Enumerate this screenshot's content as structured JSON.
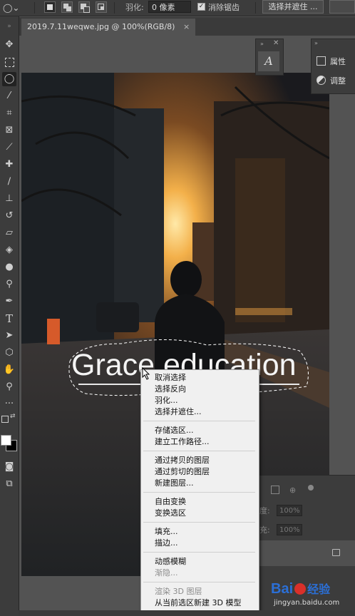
{
  "options_bar": {
    "feather_label": "羽化:",
    "feather_value": "0 像素",
    "antialias_label": "消除锯齿",
    "antialias_checked": true,
    "select_mask_label": "选择并遮住 ..."
  },
  "document": {
    "tab_title": "2019.7.11weqwe.jpg @ 100%(RGB/8)",
    "close_glyph": "×",
    "canvas_text": "Grace education"
  },
  "right_panels": {
    "items": [
      {
        "label": "属性",
        "icon": "properties-icon"
      },
      {
        "label": "调整",
        "icon": "adjustments-icon"
      }
    ],
    "character_glyph": "A"
  },
  "layers_panel": {
    "opacity_label": "度:",
    "opacity_value": "100%",
    "fill_label": "充:",
    "fill_value": "100%"
  },
  "context_menu": {
    "groups": [
      [
        "取消选择",
        "选择反向",
        "羽化...",
        "选择并遮住..."
      ],
      [
        "存储选区...",
        "建立工作路径..."
      ],
      [
        "通过拷贝的图层",
        "通过剪切的图层",
        "新建图层..."
      ],
      [
        "自由变换",
        "变换选区"
      ],
      [
        "填充...",
        "描边..."
      ],
      [
        "动感模糊",
        "渐隐..."
      ],
      [
        "渲染 3D 图层",
        "从当前选区新建 3D 模型"
      ]
    ],
    "disabled": [
      "渐隐...",
      "渲染 3D 图层"
    ]
  },
  "watermark": {
    "brand": "Bai",
    "brand_suffix": "经验",
    "url": "jingyan.baidu.com"
  },
  "colors": {
    "ui_dark": "#3c3c3c",
    "ui_mid": "#535353",
    "menu_bg": "#f0f0f0",
    "watermark_blue": "#2b6fd6",
    "watermark_red": "#d9302a"
  }
}
